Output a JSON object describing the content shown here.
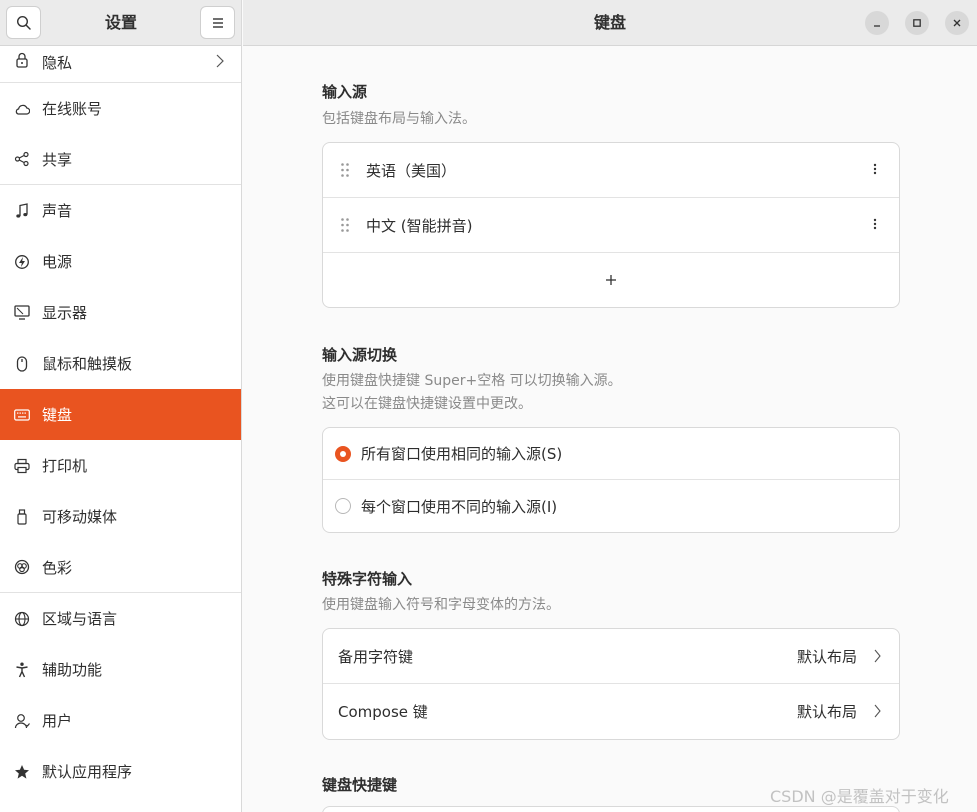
{
  "sidebar": {
    "title": "设置",
    "items": [
      {
        "label": "隐私",
        "icon": "lock-icon"
      },
      {
        "label": "在线账号",
        "icon": "cloud-icon"
      },
      {
        "label": "共享",
        "icon": "share-icon"
      },
      {
        "label": "声音",
        "icon": "music-note-icon"
      },
      {
        "label": "电源",
        "icon": "power-icon"
      },
      {
        "label": "显示器",
        "icon": "display-icon"
      },
      {
        "label": "鼠标和触摸板",
        "icon": "mouse-icon"
      },
      {
        "label": "键盘",
        "icon": "keyboard-icon"
      },
      {
        "label": "打印机",
        "icon": "printer-icon"
      },
      {
        "label": "可移动媒体",
        "icon": "removable-media-icon"
      },
      {
        "label": "色彩",
        "icon": "color-icon"
      },
      {
        "label": "区域与语言",
        "icon": "globe-icon"
      },
      {
        "label": "辅助功能",
        "icon": "accessibility-icon"
      },
      {
        "label": "用户",
        "icon": "user-icon"
      },
      {
        "label": "默认应用程序",
        "icon": "star-icon"
      }
    ]
  },
  "header": {
    "title": "键盘"
  },
  "input_sources": {
    "title": "输入源",
    "description": "包括键盘布局与输入法。",
    "items": [
      "英语（美国）",
      "中文 (智能拼音)"
    ]
  },
  "switching": {
    "title": "输入源切换",
    "description_line1": "使用键盘快捷键 Super+空格 可以切换输入源。",
    "description_line2": "这可以在键盘快捷键设置中更改。",
    "options": [
      "所有窗口使用相同的输入源(S)",
      "每个窗口使用不同的输入源(I)"
    ],
    "selected_index": 0
  },
  "special_chars": {
    "title": "特殊字符输入",
    "description": "使用键盘输入符号和字母变体的方法。",
    "rows": [
      {
        "label": "备用字符键",
        "value": "默认布局"
      },
      {
        "label": "Compose 键",
        "value": "默认布局"
      }
    ]
  },
  "shortcuts": {
    "title": "键盘快捷键"
  },
  "watermark": "CSDN @是覆盖对于变化",
  "colors": {
    "accent": "#e95420"
  }
}
